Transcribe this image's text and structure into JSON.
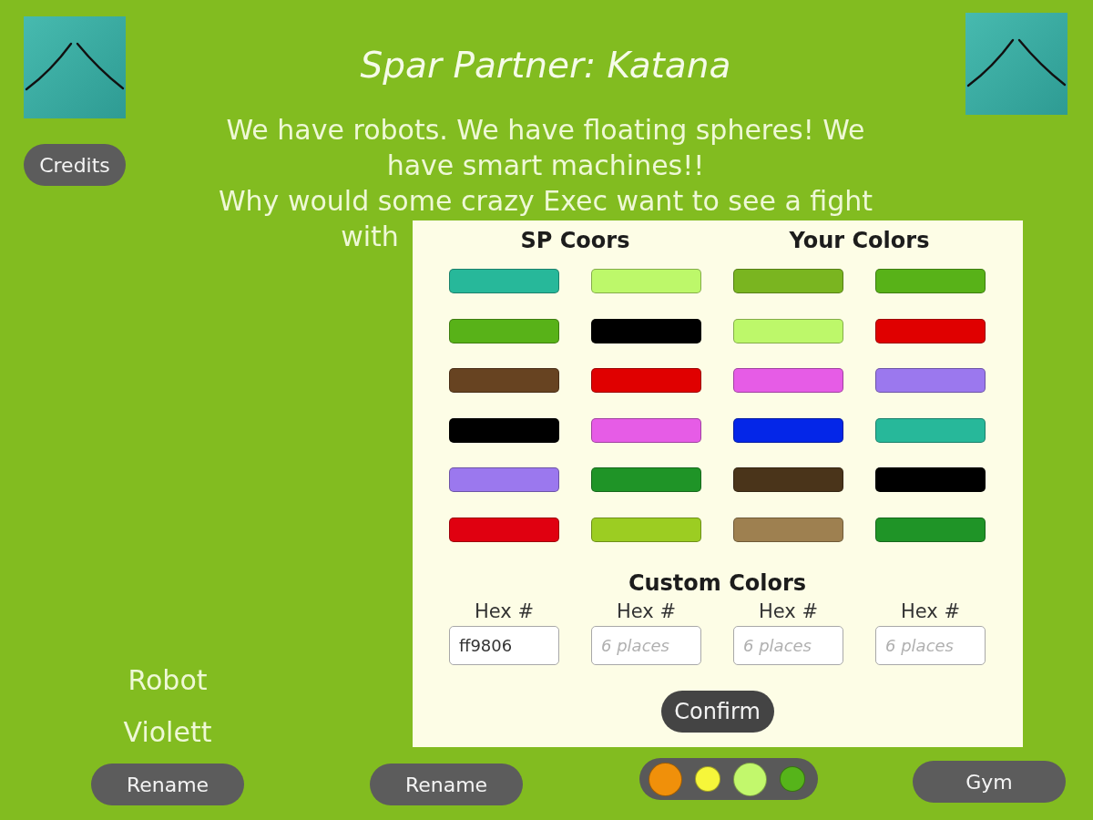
{
  "header": {
    "title": "Spar Partner: Katana",
    "credits_button": "Credits"
  },
  "intro": [
    {
      "kind": "paragraph",
      "text": "We have robots. We have floating spheres! We have smart machines!!"
    },
    {
      "kind": "line",
      "text": "Why would some crazy Exec want to see a fight"
    },
    {
      "kind": "fragment",
      "text": "with"
    }
  ],
  "dialog": {
    "groups": [
      {
        "title": "SP Coors",
        "swatches": [
          {
            "color": "#27b89a"
          },
          {
            "color": "#bdf86a"
          },
          {
            "color": "#58b218"
          },
          {
            "color": "#000000"
          },
          {
            "color": "#674321"
          },
          {
            "color": "#e00000"
          },
          {
            "color": "#000000"
          },
          {
            "color": "#e65ce6"
          },
          {
            "color": "#9b78ee"
          },
          {
            "color": "#1f9427"
          },
          {
            "color": "#e00010"
          },
          {
            "color": "#9ccd22"
          }
        ]
      },
      {
        "title": "Your Colors",
        "swatches": [
          {
            "color": "#7ab520"
          },
          {
            "color": "#58b218"
          },
          {
            "color": "#bdf86a"
          },
          {
            "color": "#e00000"
          },
          {
            "color": "#e65ce6"
          },
          {
            "color": "#9b78ee"
          },
          {
            "color": "#0426e8"
          },
          {
            "color": "#27b89a"
          },
          {
            "color": "#4a341a"
          },
          {
            "color": "#000000"
          },
          {
            "color": "#9e8050"
          },
          {
            "color": "#1f9427"
          }
        ]
      }
    ],
    "custom": {
      "title": "Custom Colors",
      "fields": [
        {
          "label": "Hex #",
          "value": "ff9806"
        },
        {
          "label": "Hex #",
          "placeholder": "6 places"
        },
        {
          "label": "Hex #",
          "placeholder": "6 places"
        },
        {
          "label": "Hex #",
          "placeholder": "6 places"
        }
      ]
    },
    "confirm_button": "Confirm"
  },
  "names": [
    "Robot",
    "Violett"
  ],
  "rename_buttons": [
    "Rename",
    "Rename"
  ],
  "color_dots": [
    {
      "color": "#f0900a",
      "selected": true
    },
    {
      "color": "#f6f63a",
      "selected": false
    },
    {
      "color": "#c2f86c",
      "selected": true
    },
    {
      "color": "#56b41a",
      "selected": false
    }
  ],
  "gym_button": "Gym"
}
